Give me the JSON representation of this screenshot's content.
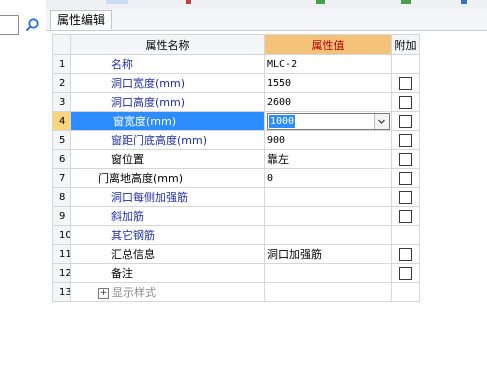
{
  "tabs": {
    "active": "属性编辑"
  },
  "grid": {
    "headers": {
      "name": "属性名称",
      "value": "属性值",
      "extra": "附加"
    },
    "rows": [
      {
        "idx": "1",
        "name": "名称",
        "value": "MLC-2",
        "checkbox": false,
        "color": "blue",
        "cjk": false
      },
      {
        "idx": "2",
        "name": "洞口宽度(mm)",
        "value": "1550",
        "checkbox": true,
        "color": "blue",
        "cjk": false
      },
      {
        "idx": "3",
        "name": "洞口高度(mm)",
        "value": "2600",
        "checkbox": true,
        "color": "blue",
        "cjk": false
      },
      {
        "idx": "4",
        "name": "窗宽度(mm)",
        "value": "1000",
        "checkbox": true,
        "color": "black",
        "cjk": false,
        "selected": true
      },
      {
        "idx": "5",
        "name": "窗距门底高度(mm)",
        "value": "900",
        "checkbox": true,
        "color": "blue",
        "cjk": false
      },
      {
        "idx": "6",
        "name": "窗位置",
        "value": "靠左",
        "checkbox": true,
        "color": "black",
        "cjk": true
      },
      {
        "idx": "7",
        "name": "门离地高度(mm)",
        "value": "0",
        "checkbox": true,
        "color": "black",
        "cjk": false
      },
      {
        "idx": "8",
        "name": "洞口每侧加强筋",
        "value": "",
        "checkbox": true,
        "color": "blue",
        "cjk": false
      },
      {
        "idx": "9",
        "name": "斜加筋",
        "value": "",
        "checkbox": true,
        "color": "blue",
        "cjk": false
      },
      {
        "idx": "10",
        "name": "其它钢筋",
        "value": "",
        "checkbox": false,
        "color": "blue",
        "cjk": false
      },
      {
        "idx": "11",
        "name": "汇总信息",
        "value": "洞口加强筋",
        "checkbox": true,
        "color": "black",
        "cjk": true
      },
      {
        "idx": "12",
        "name": "备注",
        "value": "",
        "checkbox": true,
        "color": "black",
        "cjk": false
      },
      {
        "idx": "13",
        "name": "显示样式",
        "value": "",
        "checkbox": false,
        "color": "gray",
        "cjk": false,
        "expandable": true
      }
    ]
  },
  "icons": {
    "search": "search-icon",
    "dropdown": "chevron-down-icon",
    "expand": "plus-icon"
  },
  "colors": {
    "header_value_bg": "#f5c27a",
    "header_value_text": "#b50000",
    "selection": "#2d8cff",
    "selected_index_bg": "#fcd47e",
    "blue_text": "#1f2fa8"
  }
}
